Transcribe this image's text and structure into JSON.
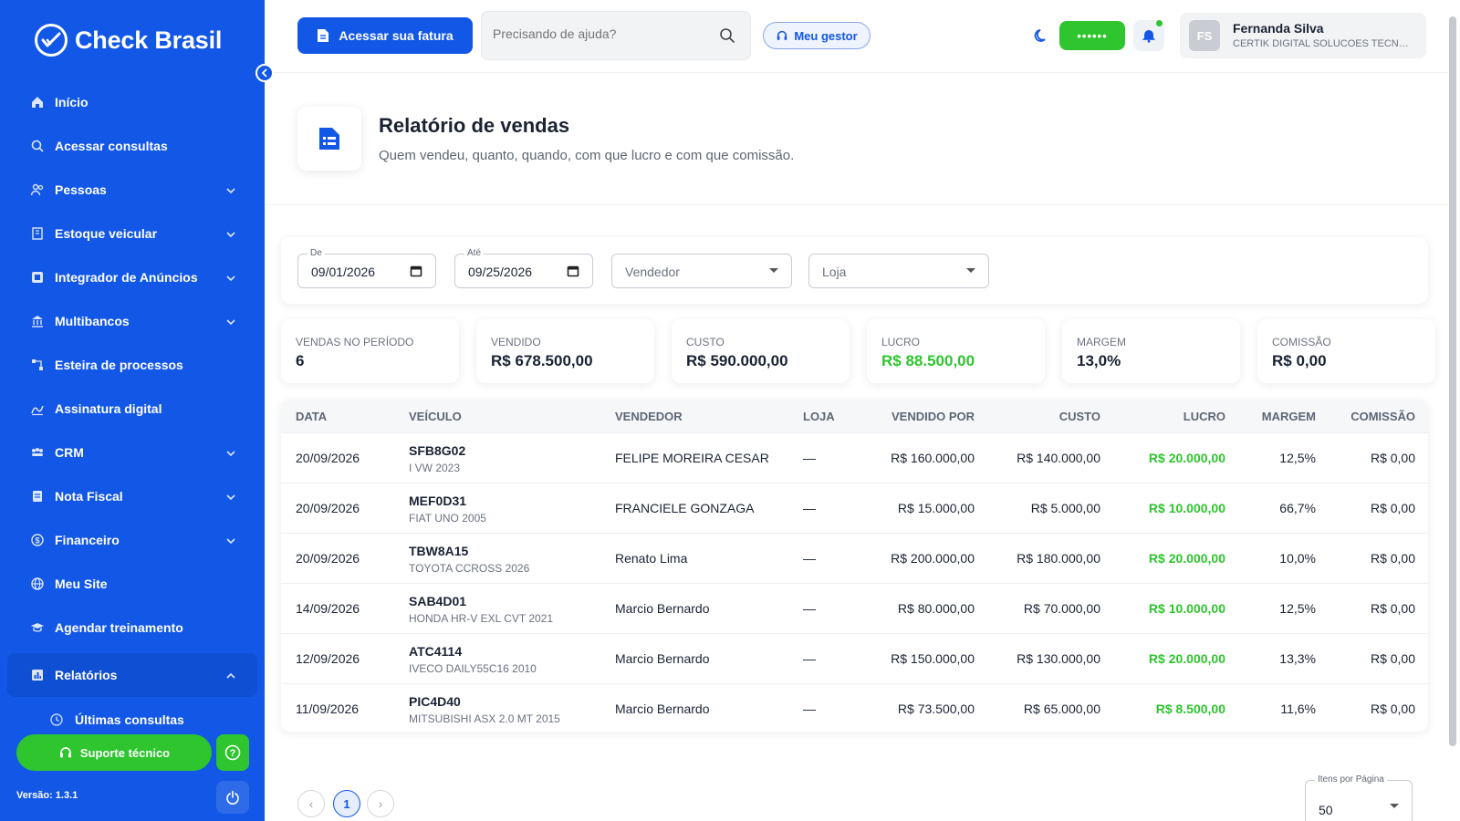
{
  "sidebar": {
    "brand": "Check Brasil",
    "items": [
      {
        "label": "Início",
        "icon": "home-icon",
        "expandable": false
      },
      {
        "label": "Acessar consultas",
        "icon": "search-icon",
        "expandable": false
      },
      {
        "label": "Pessoas",
        "icon": "people-icon",
        "expandable": true
      },
      {
        "label": "Estoque veicular",
        "icon": "building-icon",
        "expandable": true
      },
      {
        "label": "Integrador de Anúncios",
        "icon": "integrator-icon",
        "expandable": true
      },
      {
        "label": "Multibancos",
        "icon": "bank-icon",
        "expandable": true
      },
      {
        "label": "Esteira de processos",
        "icon": "process-icon",
        "expandable": false
      },
      {
        "label": "Assinatura digital",
        "icon": "signature-icon",
        "expandable": false
      },
      {
        "label": "CRM",
        "icon": "crm-icon",
        "expandable": true
      },
      {
        "label": "Nota Fiscal",
        "icon": "invoice-icon",
        "expandable": true
      },
      {
        "label": "Financeiro",
        "icon": "finance-icon",
        "expandable": true
      },
      {
        "label": "Meu Site",
        "icon": "globe-icon",
        "expandable": false
      },
      {
        "label": "Agendar treinamento",
        "icon": "training-icon",
        "expandable": false
      },
      {
        "label": "Relatórios",
        "icon": "report-icon",
        "expandable": true,
        "active": true
      }
    ],
    "sub_items": [
      {
        "label": "Últimas consultas",
        "icon": "history-icon"
      }
    ],
    "support_label": "Suporte técnico",
    "version": "Versão: 1.3.1"
  },
  "header": {
    "invoice_button": "Acessar sua fatura",
    "search_placeholder": "Precisando de ajuda?",
    "manager_button": "Meu gestor",
    "masked_pill": "••••••",
    "user": {
      "initials": "FS",
      "name": "Fernanda Silva",
      "company": "CERTIK DIGITAL SOLUCOES TECNOLOGICAS"
    }
  },
  "page": {
    "title": "Relatório de vendas",
    "subtitle": "Quem vendeu, quanto, quando, com que lucro e com que comissão."
  },
  "filters": {
    "from_label": "De",
    "from_value": "09/01/2026",
    "to_label": "Até",
    "to_value": "09/25/2026",
    "seller_placeholder": "Vendedor",
    "store_placeholder": "Loja"
  },
  "kpis": [
    {
      "label": "Vendas no período",
      "value": "6",
      "green": false
    },
    {
      "label": "Vendido",
      "value": "R$ 678.500,00",
      "green": false
    },
    {
      "label": "Custo",
      "value": "R$ 590.000,00",
      "green": false
    },
    {
      "label": "Lucro",
      "value": "R$ 88.500,00",
      "green": true
    },
    {
      "label": "Margem",
      "value": "13,0%",
      "green": false
    },
    {
      "label": "Comissão",
      "value": "R$ 0,00",
      "green": false
    }
  ],
  "table": {
    "headers": [
      "Data",
      "Veículo",
      "Vendedor",
      "Loja",
      "Vendido por",
      "Custo",
      "Lucro",
      "Margem",
      "Comissão"
    ],
    "rows": [
      {
        "date": "20/09/2026",
        "plate": "SFB8G02",
        "model": "I VW 2023",
        "seller": "FELIPE MOREIRA CESAR",
        "store": "—",
        "sold": "R$ 160.000,00",
        "cost": "R$ 140.000,00",
        "profit": "R$ 20.000,00",
        "margin": "12,5%",
        "commission": "R$ 0,00"
      },
      {
        "date": "20/09/2026",
        "plate": "MEF0D31",
        "model": "FIAT UNO 2005",
        "seller": "FRANCIELE GONZAGA",
        "store": "—",
        "sold": "R$ 15.000,00",
        "cost": "R$ 5.000,00",
        "profit": "R$ 10.000,00",
        "margin": "66,7%",
        "commission": "R$ 0,00"
      },
      {
        "date": "20/09/2026",
        "plate": "TBW8A15",
        "model": "TOYOTA CCROSS 2026",
        "seller": "Renato Lima",
        "store": "—",
        "sold": "R$ 200.000,00",
        "cost": "R$ 180.000,00",
        "profit": "R$ 20.000,00",
        "margin": "10,0%",
        "commission": "R$ 0,00"
      },
      {
        "date": "14/09/2026",
        "plate": "SAB4D01",
        "model": "HONDA HR-V EXL CVT 2021",
        "seller": "Marcio Bernardo",
        "store": "—",
        "sold": "R$ 80.000,00",
        "cost": "R$ 70.000,00",
        "profit": "R$ 10.000,00",
        "margin": "12,5%",
        "commission": "R$ 0,00"
      },
      {
        "date": "12/09/2026",
        "plate": "ATC4114",
        "model": "IVECO DAILY55C16 2010",
        "seller": "Marcio Bernardo",
        "store": "—",
        "sold": "R$ 150.000,00",
        "cost": "R$ 130.000,00",
        "profit": "R$ 20.000,00",
        "margin": "13,3%",
        "commission": "R$ 0,00"
      },
      {
        "date": "11/09/2026",
        "plate": "PIC4D40",
        "model": "MITSUBISHI ASX 2.0 MT 2015",
        "seller": "Marcio Bernardo",
        "store": "—",
        "sold": "R$ 73.500,00",
        "cost": "R$ 65.000,00",
        "profit": "R$ 8.500,00",
        "margin": "11,6%",
        "commission": "R$ 0,00"
      }
    ]
  },
  "pagination": {
    "prev": "‹",
    "current_page": "1",
    "next": "›",
    "items_per_page_label": "Itens por Página",
    "items_per_page": "50"
  },
  "colors": {
    "primary": "#1257e6",
    "success": "#2ec52e"
  }
}
